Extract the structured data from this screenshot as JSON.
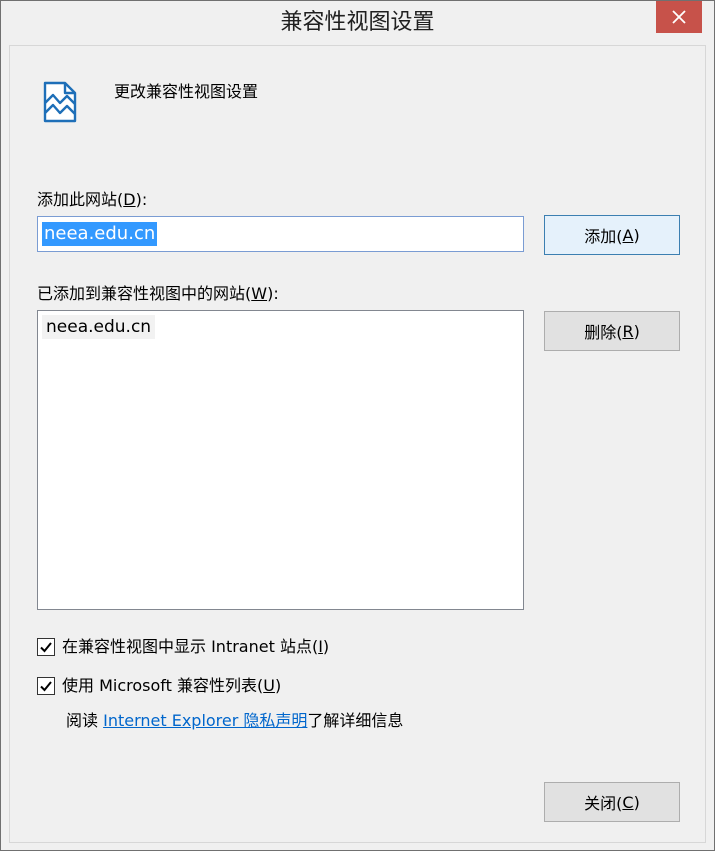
{
  "window": {
    "title": "兼容性视图设置",
    "close_icon": "close-icon"
  },
  "header": {
    "icon": "broken-page-icon",
    "text": "更改兼容性视图设置"
  },
  "add_site": {
    "label_prefix": "添加此网站(",
    "label_key": "D",
    "label_suffix": "):",
    "value": "neea.edu.cn",
    "button_prefix": "添加(",
    "button_key": "A",
    "button_suffix": ")"
  },
  "added_sites": {
    "label_prefix": "已添加到兼容性视图中的网站(",
    "label_key": "W",
    "label_suffix": "):",
    "items": [
      "neea.edu.cn"
    ],
    "remove_prefix": "删除(",
    "remove_key": "R",
    "remove_suffix": ")"
  },
  "options": {
    "intranet": {
      "checked": true,
      "label_prefix": "在兼容性视图中显示 Intranet 站点(",
      "label_key": "I",
      "label_suffix": ")"
    },
    "ms_list": {
      "checked": true,
      "label_prefix": "使用 Microsoft 兼容性列表(",
      "label_key": "U",
      "label_suffix": ")"
    }
  },
  "info": {
    "prefix": "阅读 ",
    "link": "Internet Explorer 隐私声明",
    "suffix": "了解详细信息"
  },
  "footer": {
    "close_prefix": "关闭(",
    "close_key": "C",
    "close_suffix": ")"
  },
  "colors": {
    "close_button": "#c7524a",
    "selection": "#3399ff",
    "link": "#0066cc"
  }
}
